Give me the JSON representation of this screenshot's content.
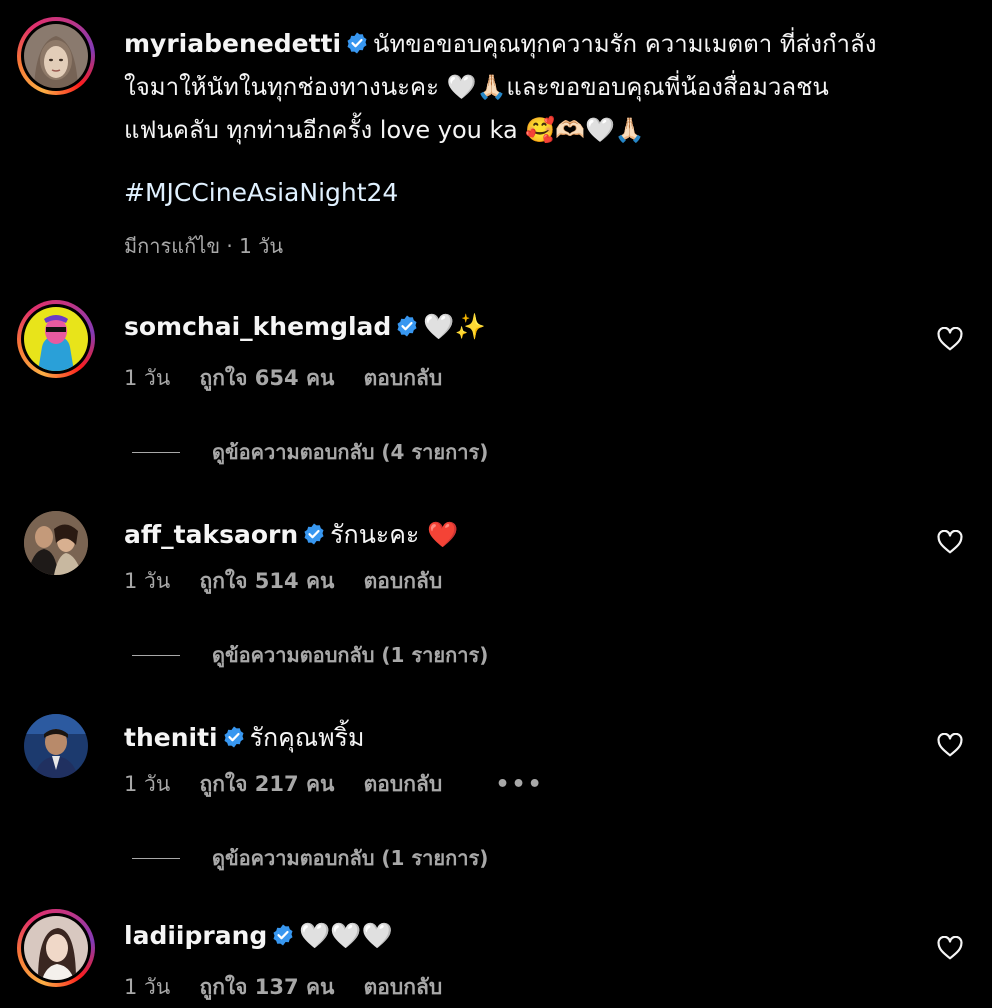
{
  "post": {
    "username": "myriabenedetti",
    "caption_lines": [
      "นัทขอขอบคุณทุกความรัก ความเมตตา ที่ส่งกำลัง",
      "ใจมาให้นัทในทุกช่องทางนะคะ 🤍🙏🏻และขอขอบคุณพี่น้องสื่อมวลชน",
      "แฟนคลับ ทุกท่านอีกครั้ง love you ka 🥰🫶🏻🤍🙏🏻"
    ],
    "hashtag": "#MJCCineAsiaNight24",
    "edited_label": "มีการแก้ไข · 1 วัน"
  },
  "comments": [
    {
      "username": "somchai_khemglad",
      "text": "🤍✨",
      "time": "1 วัน",
      "likes": "ถูกใจ 654 คน",
      "reply": "ตอบกลับ",
      "view_replies": "ดูข้อความตอบกลับ (4 รายการ)"
    },
    {
      "username": "aff_taksaorn",
      "text": "รักนะคะ ❤️",
      "time": "1 วัน",
      "likes": "ถูกใจ 514 คน",
      "reply": "ตอบกลับ",
      "view_replies": "ดูข้อความตอบกลับ (1 รายการ)"
    },
    {
      "username": "theniti",
      "text": "รักคุณพริ้ม",
      "time": "1 วัน",
      "likes": "ถูกใจ 217 คน",
      "reply": "ตอบกลับ",
      "more": "•••",
      "view_replies": "ดูข้อความตอบกลับ (1 รายการ)"
    },
    {
      "username": "ladiiprang",
      "text": "🤍🤍🤍",
      "time": "1 วัน",
      "likes": "ถูกใจ 137 คน",
      "reply": "ตอบกลับ"
    }
  ],
  "colors": {
    "background": "#000000",
    "text_primary": "#f5f5f5",
    "text_secondary": "#a8a8a8",
    "verified_blue": "#3897f0",
    "hashtag": "#e0f1ff"
  }
}
